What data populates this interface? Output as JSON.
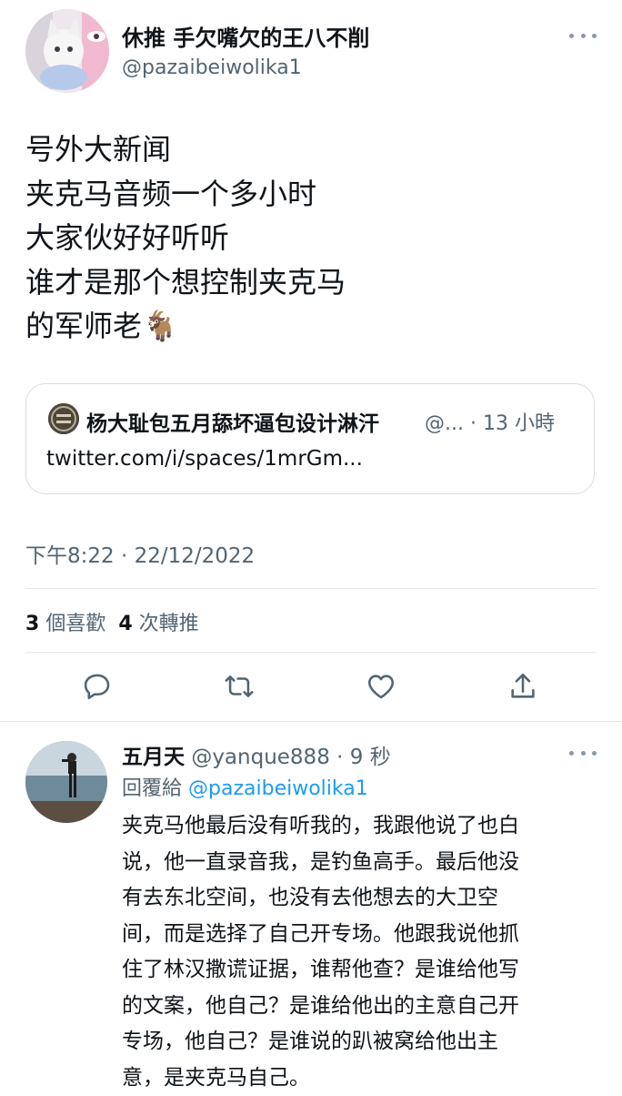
{
  "tweet": {
    "display_name": "休推 手欠嘴欠的王八不削",
    "handle": "@pazaibeiwolika1",
    "text_lines": [
      "号外大新闻",
      "夹克马音频一个多小时",
      "大家伙好好听听",
      "谁才是那个想控制夹克马",
      "的军师老🐐"
    ],
    "quote": {
      "author": "杨大耻包五月舔坏逼包设计淋汗",
      "meta": "@... · 13 小時",
      "link": "twitter.com/i/spaces/1mrGm..."
    },
    "timestamp": "下午8:22 · 22/12/2022",
    "stats": {
      "likes_count": "3",
      "likes_label": "個喜歡",
      "retweets_count": "4",
      "retweets_label": "次轉推"
    },
    "actions": [
      "reply-icon",
      "retweet-icon",
      "like-icon",
      "share-icon"
    ]
  },
  "reply": {
    "display_name": "五月天",
    "handle_time": "@yanque888 · 9 秒",
    "reply_label": "回覆給",
    "reply_to": "@pazaibeiwolika1",
    "text_lines": [
      "夹克马他最后没有听我的，我跟他说了也白",
      "说，他一直录音我，是钓鱼高手。最后他没",
      "有去东北空间，也没有去他想去的大卫空",
      "间，而是选择了自己开专场。他跟我说他抓",
      "住了林汉撒谎证据，谁帮他查？是谁给他写",
      "的文案，他自己？是谁给他出的主意自己开",
      "专场，他自己？是谁说的趴被窝给他出主",
      "意，是夹克马自己。"
    ]
  },
  "colors": {
    "text": "#0f1419",
    "muted": "#536471",
    "accent": "#1d9bf0",
    "border": "#d6dde2"
  }
}
